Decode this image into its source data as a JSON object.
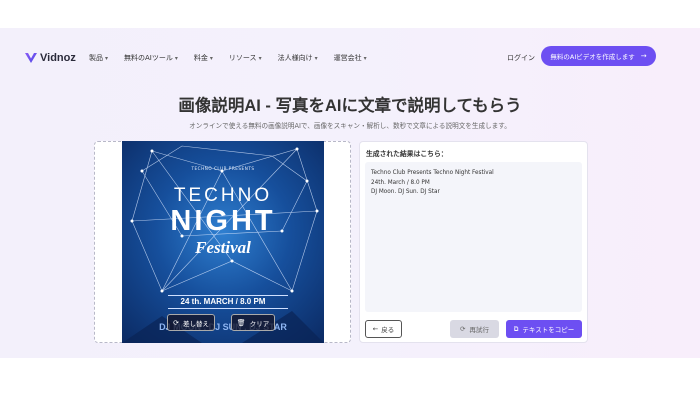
{
  "brand": {
    "name": "Vidnoz",
    "accent": "#6d4ff2"
  },
  "nav": {
    "items": [
      {
        "label": "製品"
      },
      {
        "label": "無料のAIツール"
      },
      {
        "label": "料金"
      },
      {
        "label": "リソース"
      },
      {
        "label": "法人様向け"
      },
      {
        "label": "運営会社"
      }
    ],
    "login": "ログイン",
    "cta": "無料のAIビデオを作成します"
  },
  "hero": {
    "title": "画像説明AI - 写真をAIに文章で説明してもらう",
    "subtitle": "オンラインで使える無料の画像説明AIで、画像をスキャン・解析し、数秒で文章による説明文を生成します。"
  },
  "poster": {
    "presents": "TECHNO CLUB PRESENTS",
    "line1": "TECHNO",
    "line2": "NIGHT",
    "line3": "Festival",
    "date": "24 th. MARCH / 8.0 PM",
    "djs": "DJ MOON . DJ SUN . DJ STAR"
  },
  "upload": {
    "replace_label": "差し替え",
    "clear_label": "クリア"
  },
  "result": {
    "label": "生成された結果はこちら：",
    "lines": [
      "Techno Club Presents Techno Night Festival",
      "24th. March / 8.0 PM",
      "DJ Moon. DJ Sun. DJ Star"
    ],
    "back_label": "戻る",
    "regen_label": "再試行",
    "copy_label": "テキストをコピー"
  },
  "icons": {
    "logo": "vidnoz-logo-icon",
    "chevron": "chevron-down-icon",
    "arrow": "arrow-right-icon",
    "replace": "refresh-icon",
    "clear": "trash-icon",
    "back": "arrow-left-icon",
    "regen": "refresh-icon",
    "copy": "copy-icon"
  }
}
